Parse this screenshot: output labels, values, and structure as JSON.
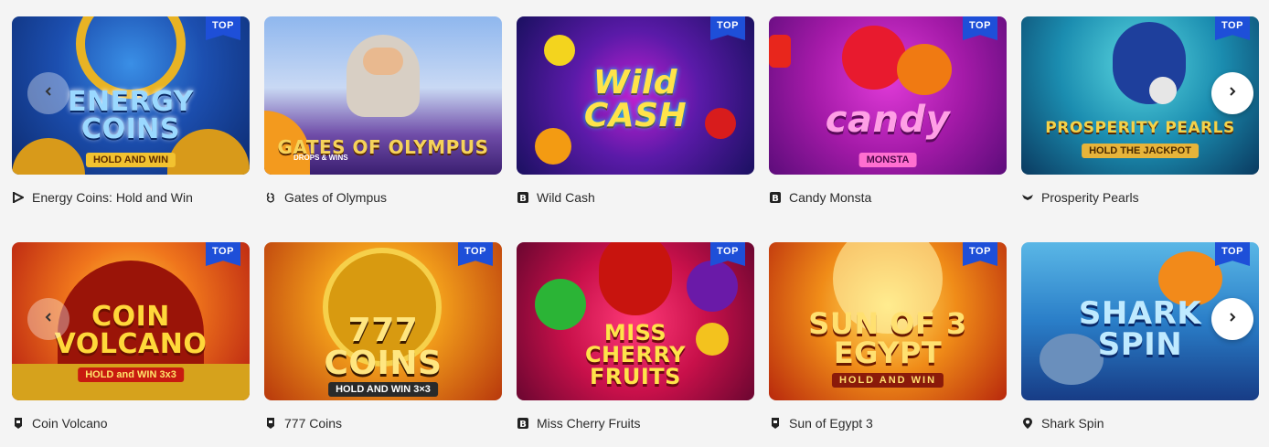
{
  "top_badge": "TOP",
  "rows": [
    {
      "games": [
        {
          "name": "Energy Coins: Hold and Win",
          "art": "ENERGY\nCOINS",
          "art_sub": "HOLD AND WIN",
          "provider_icon": "play-triangle-icon"
        },
        {
          "name": "Gates of Olympus",
          "art": "GATES OF OLYMPUS",
          "art_sub": "DROPS & WINS",
          "provider_icon": "pragmatic-icon"
        },
        {
          "name": "Wild Cash",
          "art": "Wild\nCASH",
          "art_sub": "",
          "provider_icon": "bgaming-icon"
        },
        {
          "name": "Candy Monsta",
          "art": "candy",
          "art_sub": "MONSTA",
          "provider_icon": "bgaming-icon"
        },
        {
          "name": "Prosperity Pearls",
          "art": "PROSPERITY PEARLS",
          "art_sub": "HOLD THE JACKPOT",
          "provider_icon": "wings-icon"
        }
      ]
    },
    {
      "games": [
        {
          "name": "Coin Volcano",
          "art": "COIN\nVOLCANO",
          "art_sub": "HOLD and WIN 3x3",
          "provider_icon": "shield-icon"
        },
        {
          "name": "777 Coins",
          "art": "777\nCOINS",
          "art_sub": "HOLD AND WIN 3×3",
          "provider_icon": "shield-icon"
        },
        {
          "name": "Miss Cherry Fruits",
          "art": "MISS\nCHERRY\nFRUITS",
          "art_sub": "",
          "provider_icon": "bgaming-icon"
        },
        {
          "name": "Sun of Egypt 3",
          "art": "SUN OF 3\nEGYPT",
          "art_sub": "HOLD AND WIN",
          "provider_icon": "shield-icon"
        },
        {
          "name": "Shark Spin",
          "art": "SHARK\nSPIN",
          "art_sub": "",
          "provider_icon": "location-pin-icon"
        }
      ]
    }
  ],
  "colors": {
    "badge": "#1e4fd8",
    "caption_text": "#2b2b2b",
    "background": "#f4f4f4"
  }
}
